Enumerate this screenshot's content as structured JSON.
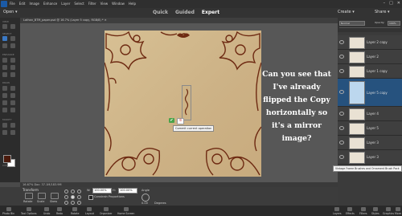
{
  "menubar": {
    "items": [
      "File",
      "Edit",
      "Image",
      "Enhance",
      "Layer",
      "Select",
      "Filter",
      "View",
      "Window",
      "Help"
    ],
    "window_controls": [
      "–",
      "□",
      "✕"
    ]
  },
  "modebar": {
    "open_label": "Open ▾",
    "tabs": [
      "Quick",
      "Guided",
      "Expert"
    ],
    "active_tab": "Expert",
    "create_label": "Create ▾",
    "share_label": "Share ▾"
  },
  "document": {
    "tab_title": "Lathan_BTM_paper.psd @ 16.7% (Layer 5 copy, RGB/8) * ✕",
    "status": "16.67%   Doc: 37.1M/183.9M"
  },
  "toolbox": {
    "sections": [
      "VIEW",
      "SELECT",
      "ENHANCE",
      "DRAW",
      "MODIFY",
      "COLOR"
    ],
    "fg_color": "#4a1a0c",
    "bg_color": "#ffffff"
  },
  "canvas": {
    "commit_icon": "✔",
    "cancel_icon": "⦸",
    "tooltip": "Commit current operation",
    "overlay_text": "Can you see that I've already flipped the Copy horizontally so it's a mirror image?"
  },
  "options": {
    "section_label": "Transform",
    "buttons": [
      "Rotate",
      "Scale",
      "Skew"
    ],
    "width_label": "W:",
    "width_value": "100.00%",
    "height_label": "H:",
    "height_value": "100.00%",
    "constrain_label": "Constrain Proportions",
    "angle_label": "Angle",
    "angle_value": "0.00",
    "angle_unit": "Degrees"
  },
  "layers_panel": {
    "blend_mode": "Normal",
    "opacity_label": "Opacity:",
    "opacity_value": "100%",
    "layers": [
      {
        "name": "Layer 2 copy",
        "selected": false
      },
      {
        "name": "Layer 2",
        "selected": false
      },
      {
        "name": "Layer 1 copy",
        "selected": false
      },
      {
        "name": "Layer 5 copy",
        "selected": true
      },
      {
        "name": "Layer 4",
        "selected": false
      },
      {
        "name": "Layer 5",
        "selected": false
      },
      {
        "name": "Layer 3",
        "selected": false
      },
      {
        "name": "Layer 3",
        "selected": false
      }
    ],
    "tooltip": "Vintage Frame Brushes and Ornament Brush Pack"
  },
  "bottombar": {
    "left_items": [
      "Photo Bin",
      "Tool Options",
      "Undo",
      "Redo",
      "Rotate",
      "Layout",
      "Organizer",
      "Home Screen"
    ],
    "right_items": [
      "Layers",
      "Effects",
      "Filters",
      "Styles",
      "Graphics",
      "More"
    ]
  }
}
